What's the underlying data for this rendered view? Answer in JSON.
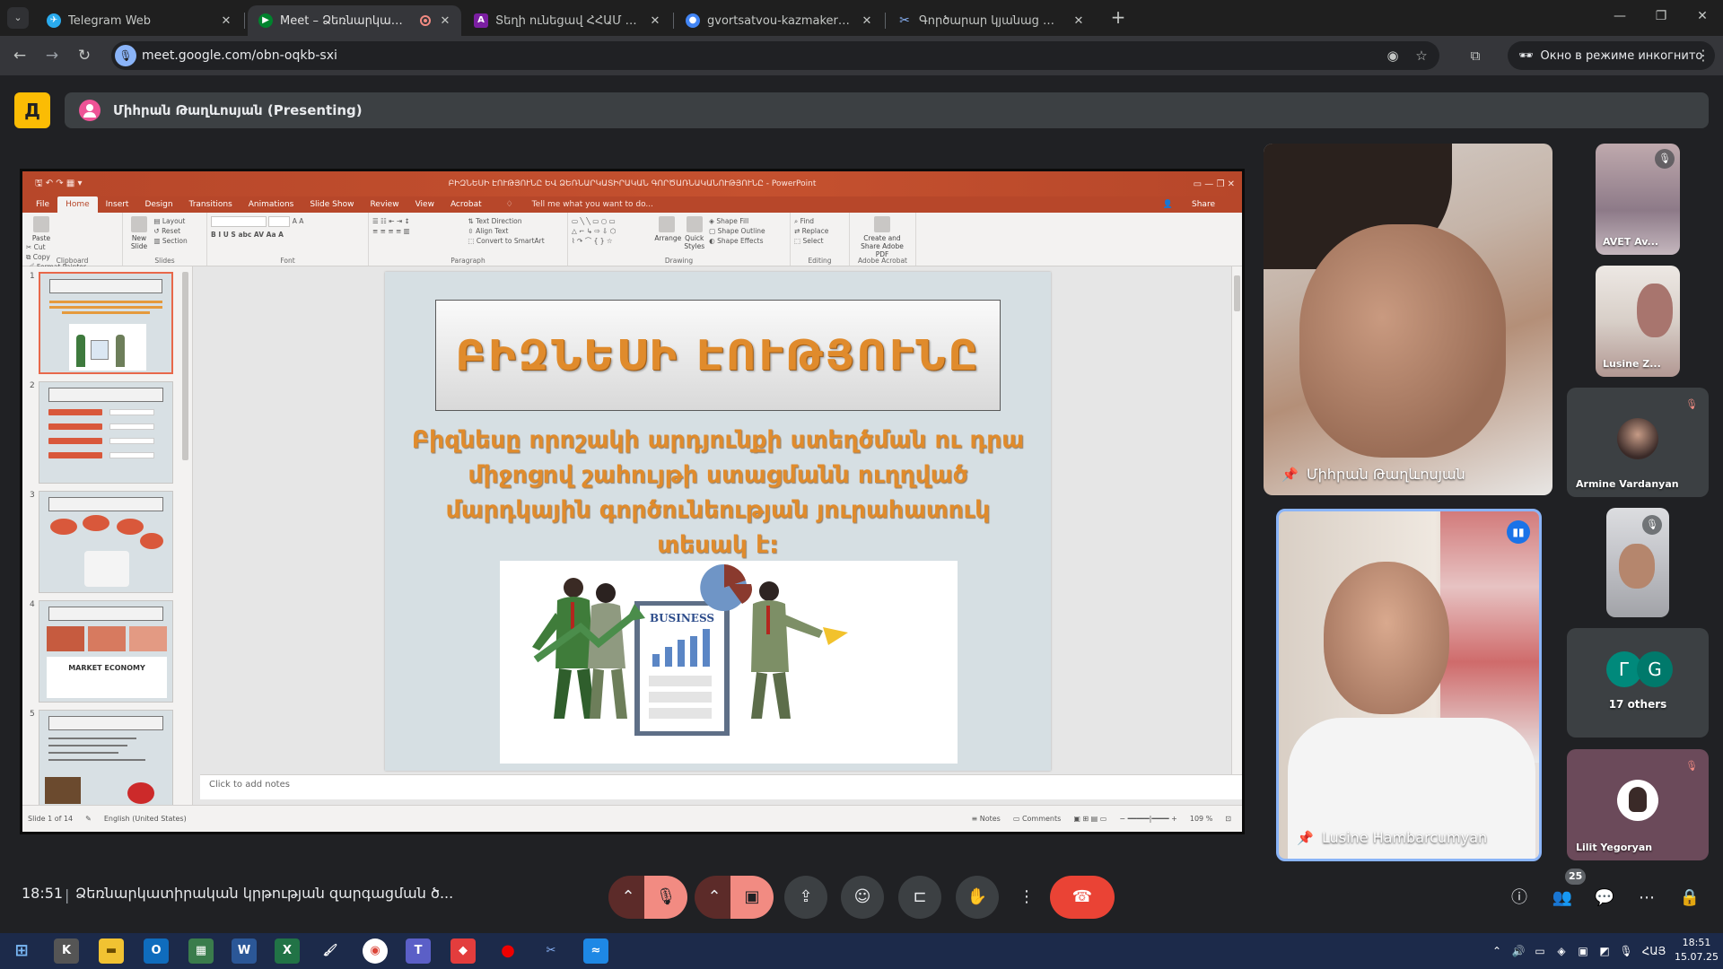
{
  "browser": {
    "tabs": [
      {
        "title": "Telegram Web",
        "favicon_color": "#2aabee",
        "active": false
      },
      {
        "title": "Meet – Ձեռնարկատիրակ",
        "favicon_color": "#00832d",
        "active": true,
        "recording": true
      },
      {
        "title": "Տեղի ունեցավ ՀՀԱՄ խորհրդ",
        "favicon_color": "#7b1fa2",
        "active": false
      },
      {
        "title": "gvortsatvou-kazmakerpvouthy",
        "favicon_color": "#4285f4",
        "active": false
      },
      {
        "title": "Գործարար կյանաց ակում",
        "favicon_color": "#8ab4f8",
        "active": false
      }
    ],
    "url": "meet.google.com/obn-oqkb-sxi",
    "incognito_label": "Окно в режиме инкогнито"
  },
  "meet": {
    "presenting_label": "Միհրան Թաղևոսյան (Presenting)",
    "clock": "18:51",
    "meeting_title": "Ձեռնարկատիրական կրթության զարգացման ծ...",
    "participant_count": "25",
    "main_tiles": [
      {
        "name": "Միհրան Թաղևոսյան",
        "pinned": true
      },
      {
        "name": "Lusine Hambarcumyan",
        "pinned": true,
        "speaking": true
      }
    ],
    "side_tiles": [
      {
        "name": "AVET Av...",
        "muted": true
      },
      {
        "name": "Lusine Z...",
        "muted": false
      },
      {
        "name": "Armine Vardanyan",
        "muted": true
      },
      {
        "name": "",
        "muted": true
      },
      {
        "name": "17 others",
        "letters": [
          "Г",
          "G"
        ]
      },
      {
        "name": "Lilit Yegoryan",
        "muted": true
      }
    ]
  },
  "powerpoint": {
    "window_title": "ԲԻԶՆԵՍԻ ԷՈՒԹՅՈՒՆԸ ԵՎ ՁԵՌՆԱՐԿԱՏԻՐԱԿԱՆ ԳՈՐԾԱՌՆԱԿԱՆՈՒԹՅՈՒՆԸ - PowerPoint",
    "menu": [
      "File",
      "Home",
      "Insert",
      "Design",
      "Transitions",
      "Animations",
      "Slide Show",
      "Review",
      "View",
      "Acrobat"
    ],
    "tell_me": "Tell me what you want to do...",
    "share": "Share",
    "ribbon": {
      "clipboard": {
        "label": "Clipboard",
        "paste": "Paste",
        "cut": "Cut",
        "copy": "Copy",
        "format_painter": "Format Painter"
      },
      "slides": {
        "label": "Slides",
        "new_slide": "New Slide",
        "layout": "Layout",
        "reset": "Reset",
        "section": "Section"
      },
      "font": {
        "label": "Font"
      },
      "paragraph": {
        "label": "Paragraph",
        "text_direction": "Text Direction",
        "align_text": "Align Text",
        "smartart": "Convert to SmartArt"
      },
      "drawing": {
        "label": "Drawing",
        "arrange": "Arrange",
        "quick_styles": "Quick Styles",
        "shape_fill": "Shape Fill",
        "shape_outline": "Shape Outline",
        "shape_effects": "Shape Effects"
      },
      "editing": {
        "label": "Editing",
        "find": "Find",
        "replace": "Replace",
        "select": "Select"
      },
      "acrobat": {
        "label": "Adobe Acrobat",
        "create": "Create and Share Adobe PDF"
      }
    },
    "thumbnails": [
      "1",
      "2",
      "3",
      "4",
      "5"
    ],
    "thumb_market_label": "MARKET ECONOMY",
    "slide": {
      "title": "ԲԻԶՆԵՍԻ ԷՈՒԹՅՈՒՆԸ",
      "lines": [
        "Բիզնեսը որոշակի արդյունքի ստեղծման ու դրա",
        "միջոցով շահույթի ստացմանն ուղղված",
        "մարդկային գործունեության յուրահատուկ",
        "տեսակ է:"
      ],
      "image_label": "BUSINESS"
    },
    "notes_placeholder": "Click to add notes",
    "status": {
      "slide_of": "Slide 1 of 14",
      "language": "English (United States)",
      "notes": "Notes",
      "comments": "Comments",
      "zoom": "109 %"
    }
  },
  "taskbar": {
    "time": "18:51",
    "date": "15.07.25",
    "lang": "ՀԱՅ"
  }
}
